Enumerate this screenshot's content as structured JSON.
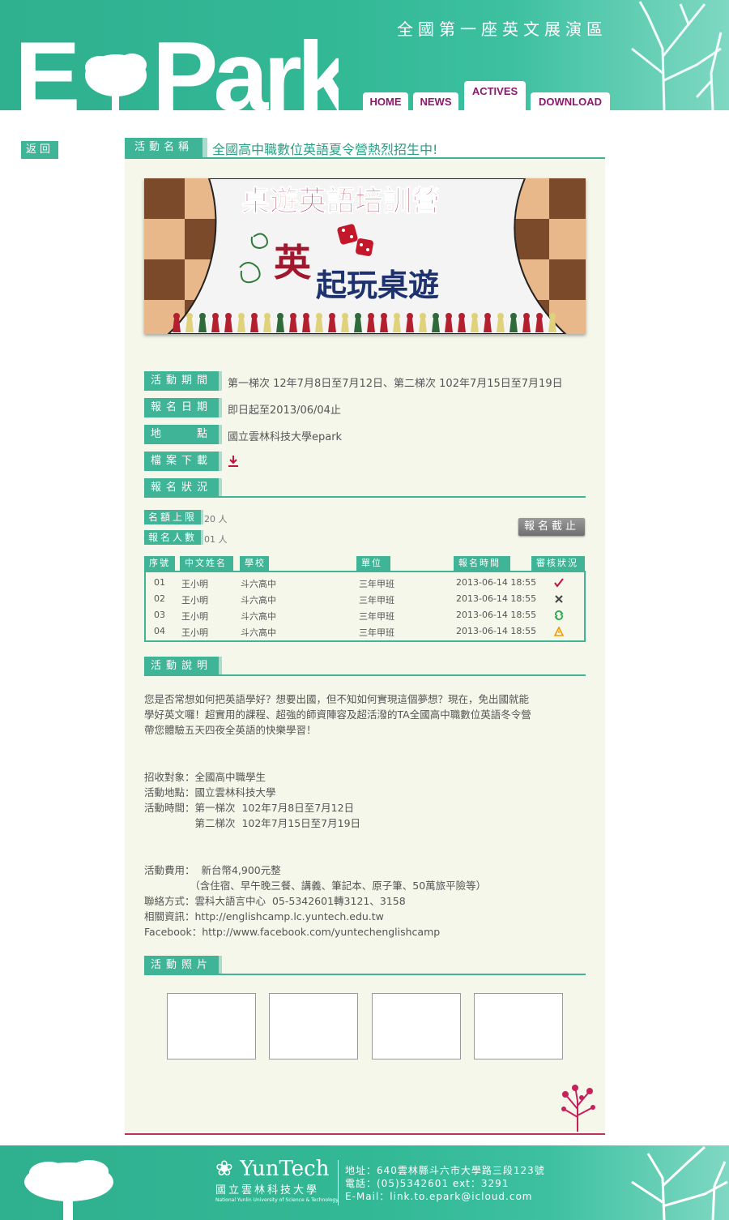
{
  "header": {
    "logo_text": "E Park",
    "tagline": "全國第一座英文展演區",
    "nav": [
      "HOME",
      "NEWS",
      "ACTIVES",
      "DOWNLOAD"
    ]
  },
  "back_label": "返回",
  "activity": {
    "name_label": "活動名稱",
    "name": "全國高中職數位英語夏令營熱烈招生中!"
  },
  "banner": {
    "headline": "桌遊英語培訓營",
    "sub_char": "英",
    "sub_text": "起玩桌遊"
  },
  "info": {
    "period_label": "活動期間",
    "period_value": "第一梯次  12年7月8日至7月12日、第二梯次  102年7月15日至7月19日",
    "reg_date_label": "報名日期",
    "reg_date_value": "即日起至2013/06/04止",
    "location_label": "地　　點",
    "location_value": "國立雲林科技大學epark",
    "download_label": "檔案下載",
    "download_icon": "download-icon"
  },
  "registration": {
    "section_label": "報名狀況",
    "quota_label": "名額上限",
    "quota_value": "20 人",
    "count_label": "報名人數",
    "count_value": "01 人",
    "closed_label": "報名截止",
    "columns": [
      "序號",
      "中文姓名",
      "學校",
      "單位",
      "報名時間",
      "審核狀況"
    ],
    "rows": [
      {
        "no": "01",
        "name": "王小明",
        "school": "斗六高中",
        "unit": "三年甲班",
        "time": "2013-06-14  18:55",
        "status_icon": "check-icon",
        "color": "#c0143c"
      },
      {
        "no": "02",
        "name": "王小明",
        "school": "斗六高中",
        "unit": "三年甲班",
        "time": "2013-06-14  18:55",
        "status_icon": "cross-icon",
        "color": "#444444"
      },
      {
        "no": "03",
        "name": "王小明",
        "school": "斗六高中",
        "unit": "三年甲班",
        "time": "2013-06-14  18:55",
        "status_icon": "refresh-icon",
        "color": "#2aa84a"
      },
      {
        "no": "04",
        "name": "王小明",
        "school": "斗六高中",
        "unit": "三年甲班",
        "time": "2013-06-14  18:55",
        "status_icon": "warning-icon",
        "color": "#f09a00"
      }
    ]
  },
  "description": {
    "section_label": "活動說明",
    "intro": [
      "您是否常想如何把英語學好？想要出國，但不知如何實現這個夢想？現在，免出國就能",
      "學好英文囉！超實用的課程、超強的師資陣容及超活潑的TA全國高中職數位英語冬令營",
      "帶您體驗五天四夜全英語的快樂學習！"
    ],
    "details": [
      "招收對象：全國高中職學生",
      "活動地點：國立雲林科技大學",
      "活動時間：第一梯次  102年7月8日至7月12日",
      "　　　　　第二梯次  102年7月15日至7月19日"
    ],
    "fee": [
      "活動費用：  新台幣4,900元整",
      "　　　　　（含住宿、早午晚三餐、講義、筆記本、原子筆、50萬旅平險等）",
      "聯絡方式：雲科大語言中心  05-5342601轉3121、3158",
      "相關資訊：http://englishcamp.lc.yuntech.edu.tw",
      "Facebook：http://www.facebook.com/yuntechenglishcamp"
    ]
  },
  "photos": {
    "section_label": "活動照片",
    "count": 4
  },
  "footer": {
    "brand": "YunTech",
    "brand_cn": "國立雲林科技大學",
    "brand_en": "National Yunlin University of Science & Technology",
    "address": "地址：640雲林縣斗六市大學路三段123號",
    "phone": "電話：(05)5342601 ext：3291",
    "email": "E-Mail：link.to.epark@icloud.com"
  },
  "colors": {
    "accent": "#3fb496",
    "nav_text": "#8a1a6e",
    "panel_bg": "#f4f7ea",
    "bottom_rule": "#b83560"
  }
}
